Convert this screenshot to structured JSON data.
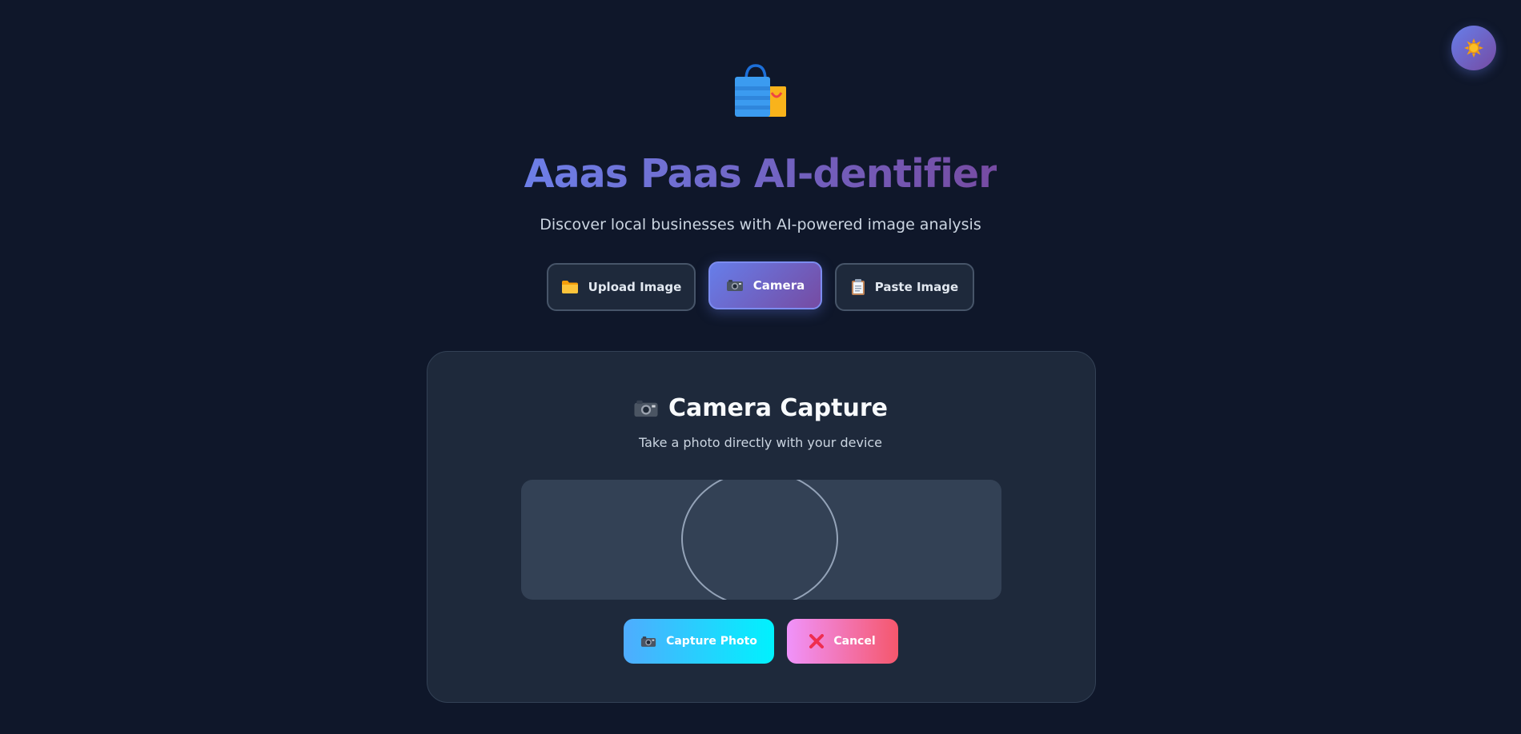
{
  "header": {
    "title": "Aaas Paas AI-dentifier",
    "subtitle": "Discover local businesses with AI-powered image analysis",
    "logo_icon": "shopping-bags-icon",
    "theme_toggle_icon": "sun-icon"
  },
  "modes": [
    {
      "label": "Upload Image",
      "icon": "folder-icon",
      "active": false
    },
    {
      "label": "Camera",
      "icon": "camera-icon",
      "active": true
    },
    {
      "label": "Paste Image",
      "icon": "clipboard-icon",
      "active": false
    }
  ],
  "camera_panel": {
    "title": "Camera Capture",
    "title_icon": "camera-icon",
    "description": "Take a photo directly with your device",
    "capture_label": "Capture Photo",
    "cancel_label": "Cancel"
  },
  "colors": {
    "background": "#0f172a",
    "card": "#1e293b",
    "accent_start": "#667eea",
    "accent_end": "#764ba2",
    "capture_start": "#4facfe",
    "capture_end": "#00f2fe",
    "cancel_start": "#f093fb",
    "cancel_end": "#f5576c"
  }
}
